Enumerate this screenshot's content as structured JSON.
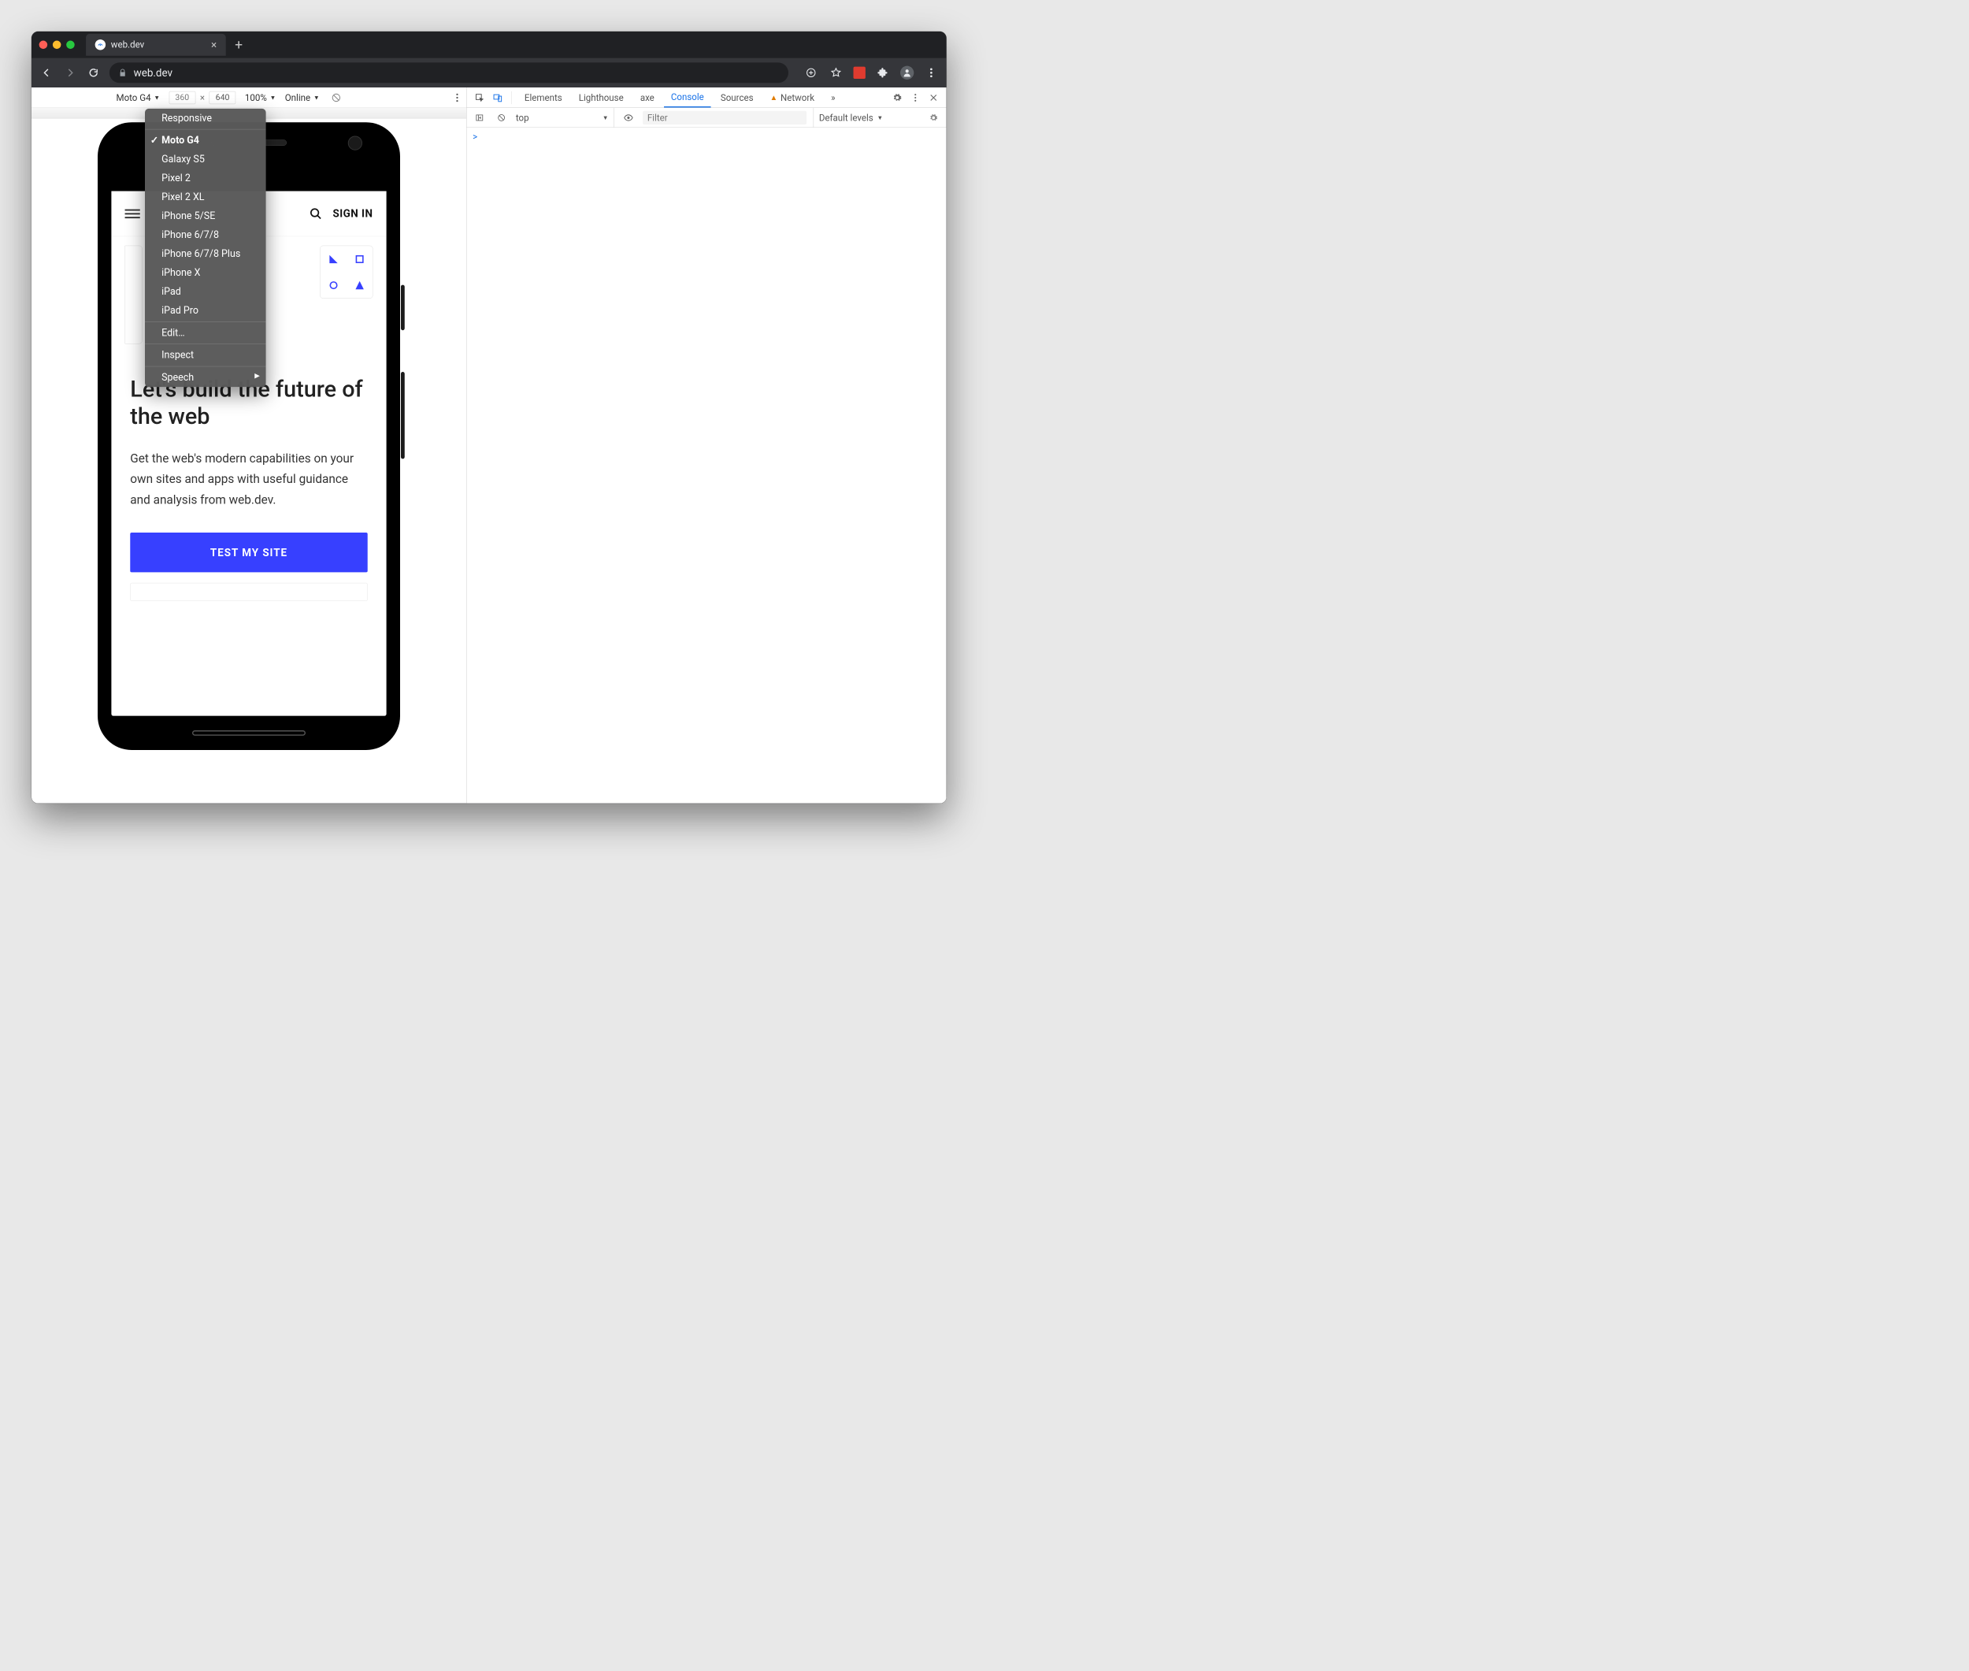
{
  "browser": {
    "tab_title": "web.dev",
    "url": "web.dev"
  },
  "device_toolbar": {
    "device": "Moto G4",
    "width": "360",
    "height": "640",
    "zoom": "100%",
    "throttle": "Online"
  },
  "device_menu": {
    "responsive": "Responsive",
    "devices": [
      "Moto G4",
      "Galaxy S5",
      "Pixel 2",
      "Pixel 2 XL",
      "iPhone 5/SE",
      "iPhone 6/7/8",
      "iPhone 6/7/8 Plus",
      "iPhone X",
      "iPad",
      "iPad Pro"
    ],
    "selected": "Moto G4",
    "edit": "Edit…",
    "inspect": "Inspect",
    "speech": "Speech"
  },
  "page": {
    "sign_in": "SIGN IN",
    "hero_title": "Let's build the future of the web",
    "hero_body": "Get the web's modern capabilities on your own sites and apps with useful guidance and analysis from web.dev.",
    "cta": "TEST MY SITE"
  },
  "devtools": {
    "tabs": [
      "Elements",
      "Lighthouse",
      "axe",
      "Console",
      "Sources",
      "Network"
    ],
    "active_tab": "Console",
    "more": "»",
    "console": {
      "context": "top",
      "filter_placeholder": "Filter",
      "levels": "Default levels",
      "prompt": ">"
    }
  }
}
